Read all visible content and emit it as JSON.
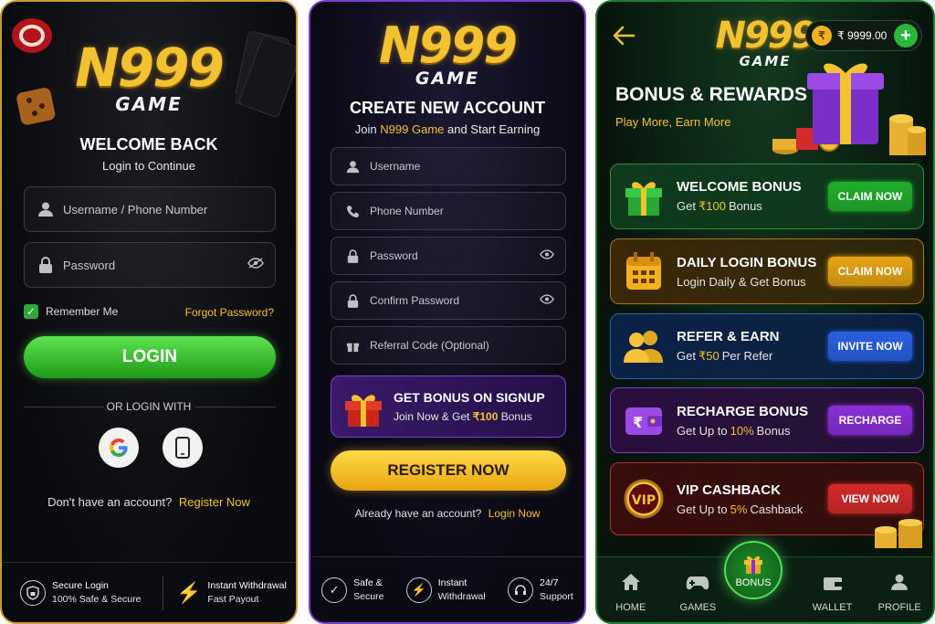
{
  "brand": {
    "logo_main": "N999",
    "logo_sub": "GAME"
  },
  "login": {
    "title": "WELCOME BACK",
    "subtitle": "Login to Continue",
    "username_placeholder": "Username / Phone Number",
    "password_placeholder": "Password",
    "remember_label": "Remember Me",
    "forgot_label": "Forgot Password?",
    "login_button": "LOGIN",
    "or_login_with": "OR LOGIN WITH",
    "no_account_text": "Don't have an account?",
    "register_link": "Register Now",
    "features": [
      {
        "title": "Secure Login",
        "sub": "100% Safe & Secure",
        "icon": "shield-icon"
      },
      {
        "title": "Instant Withdrawal",
        "sub": "Fast Payout",
        "icon": "lightning-icon"
      }
    ]
  },
  "signup": {
    "title": "CREATE NEW ACCOUNT",
    "subtitle_pre": "Join",
    "subtitle_brand": "N999 Game",
    "subtitle_post": "and Start Earning",
    "fields": [
      {
        "placeholder": "Username",
        "icon": "user-icon"
      },
      {
        "placeholder": "Phone Number",
        "icon": "phone-icon"
      },
      {
        "placeholder": "Password",
        "icon": "lock-icon"
      },
      {
        "placeholder": "Confirm Password",
        "icon": "lock-icon"
      },
      {
        "placeholder": "Referral Code (Optional)",
        "icon": "gift-icon"
      }
    ],
    "bonus_title": "GET BONUS ON SIGNUP",
    "bonus_sub_pre": "Join Now & Get",
    "bonus_amount": "₹100",
    "bonus_sub_post": "Bonus",
    "register_button": "REGISTER NOW",
    "have_account_text": "Already have an account?",
    "login_link": "Login Now",
    "features": [
      {
        "l1": "Safe &",
        "l2": "Secure",
        "icon": "shield-check-icon"
      },
      {
        "l1": "Instant",
        "l2": "Withdrawal",
        "icon": "lightning-icon"
      },
      {
        "l1": "24/7",
        "l2": "Support",
        "icon": "headset-icon"
      }
    ]
  },
  "bonus": {
    "balance": "₹ 9999.00",
    "title": "BONUS & REWARDS",
    "tagline": "Play More, Earn More",
    "cards": [
      {
        "title": "WELCOME BONUS",
        "sub_pre": "Get",
        "sub_hl": "₹100",
        "sub_post": "Bonus",
        "button": "CLAIM NOW",
        "icon": "gift-icon",
        "bg": "#0f3a1c",
        "border": "#2f8a3f",
        "btn": "#1fae2a"
      },
      {
        "title": "DAILY LOGIN BONUS",
        "sub_pre": "Login Daily & Get Bonus",
        "sub_hl": "",
        "sub_post": "",
        "button": "CLAIM NOW",
        "icon": "calendar-icon",
        "bg": "#3a2808",
        "border": "#a8761a",
        "btn": "#e6a514"
      },
      {
        "title": "REFER & EARN",
        "sub_pre": "Get",
        "sub_hl": "₹50",
        "sub_post": "Per Refer",
        "button": "INVITE NOW",
        "icon": "users-icon",
        "bg": "#0c2148",
        "border": "#2d5fb0",
        "btn": "#2a5fe0"
      },
      {
        "title": "RECHARGE BONUS",
        "sub_pre": "Get Up to",
        "sub_hl": "10%",
        "sub_post": "Bonus",
        "button": "RECHARGE",
        "icon": "wallet-icon",
        "bg": "#2a0f3e",
        "border": "#7a3fc0",
        "btn": "#8a2fd8"
      },
      {
        "title": "VIP CASHBACK",
        "sub_pre": "Get Up to",
        "sub_hl": "5%",
        "sub_post": "Cashback",
        "button": "VIEW NOW",
        "icon": "vip-icon",
        "bg": "#3a0c0c",
        "border": "#b8302a",
        "btn": "#d42a2a"
      }
    ],
    "vip_badge": "VIP",
    "nav": [
      {
        "label": "HOME",
        "icon": "home-icon"
      },
      {
        "label": "GAMES",
        "icon": "gamepad-icon"
      },
      {
        "label": "BONUS",
        "icon": "gift-icon"
      },
      {
        "label": "WALLET",
        "icon": "wallet-icon"
      },
      {
        "label": "PROFILE",
        "icon": "user-icon"
      }
    ]
  }
}
